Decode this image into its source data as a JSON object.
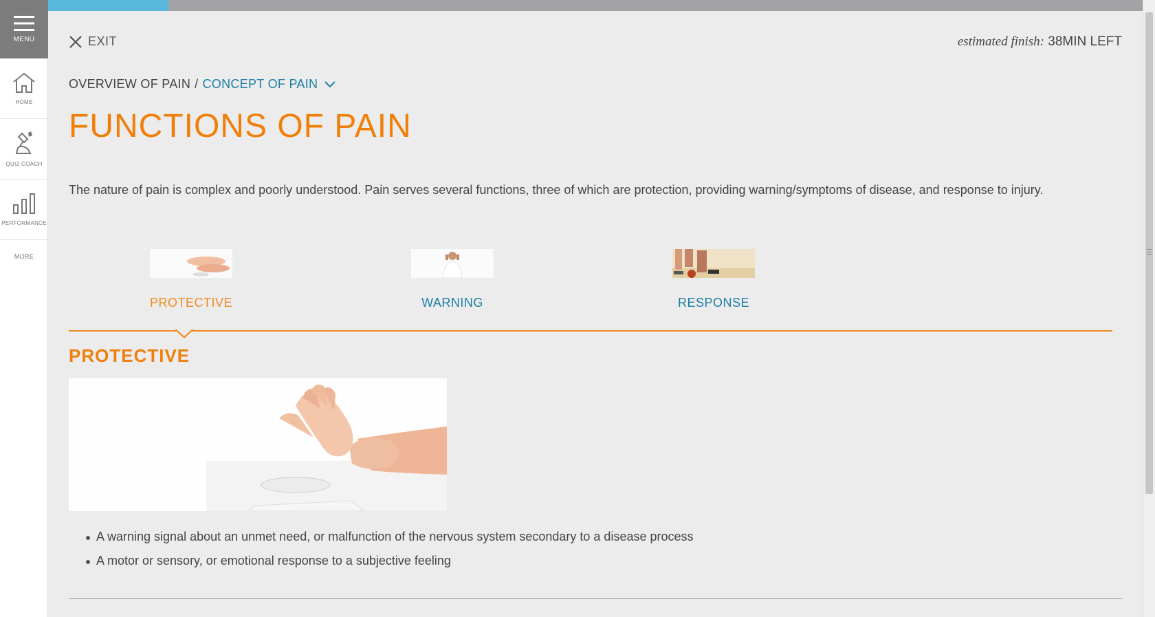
{
  "sidebar": {
    "menu_label": "MENU",
    "items": [
      {
        "label": "HOME",
        "icon": "home-icon"
      },
      {
        "label": "QUIZ COACH",
        "icon": "quiz-coach-icon"
      },
      {
        "label": "PERFORMANCE",
        "icon": "bar-chart-icon"
      }
    ],
    "more_label": "MORE"
  },
  "progress": {
    "percent": 11,
    "fill_color": "#5ab8dc",
    "track_color": "#a3a3a6"
  },
  "header": {
    "exit_label": "EXIT",
    "finish_prefix": "estimated finish:",
    "finish_value": "38MIN LEFT"
  },
  "breadcrumb": {
    "root": "OVERVIEW OF PAIN",
    "separator": "/",
    "current": "CONCEPT OF PAIN"
  },
  "page_title": "FUNCTIONS OF PAIN",
  "intro": "The nature of pain is complex and poorly understood. Pain serves several functions, three of which are protection, providing warning/symptoms of disease, and response to injury.",
  "tabs": [
    {
      "label": "PROTECTIVE",
      "active": true
    },
    {
      "label": "WARNING",
      "active": false
    },
    {
      "label": "RESPONSE",
      "active": false
    }
  ],
  "section": {
    "title": "PROTECTIVE",
    "bullets": [
      "A warning signal about an unmet need, or malfunction of the nervous system secondary to a disease process",
      "A motor or sensory, or emotional response to a subjective feeling"
    ]
  },
  "colors": {
    "accent_orange": "#f07f0a",
    "link_blue": "#1b7fa6"
  }
}
